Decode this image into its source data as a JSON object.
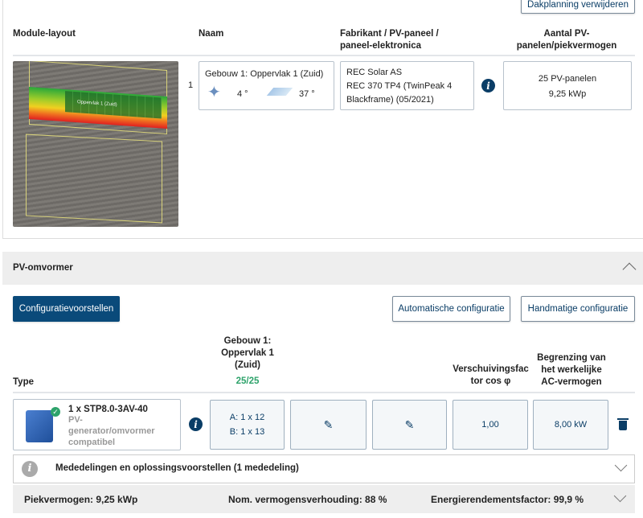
{
  "top_button": "Dakplanning verwijderen",
  "roof": {
    "headers": {
      "layout": "Module-layout",
      "name": "Naam",
      "manufacturer": "Fabrikant / PV-paneel / paneel-elektronica",
      "count": "Aantal PV-panelen/piekvermogen"
    },
    "row": {
      "index": "1",
      "name": "Gebouw 1: Oppervlak 1 (Zuid)",
      "azimuth": "4 °",
      "tilt": "37 °",
      "manufacturer": "REC Solar AS",
      "panel": "REC 370 TP4 (TwinPeak 4 Blackframe) (05/2021)",
      "panel_count": "25 PV-panelen",
      "peak_power": "9,25 kWp",
      "layout_label": "Oppervlak 1 (Zuid)"
    }
  },
  "inverter": {
    "title": "PV-omvormer",
    "buttons": {
      "proposals": "Configuratievoorstellen",
      "auto": "Automatische configuratie",
      "manual": "Handmatige configuratie"
    },
    "headers": {
      "type": "Type",
      "surface": "Gebouw 1: Oppervlak 1 (Zuid)",
      "surface_count": "25/25",
      "cos_phi": "Verschuivingsfactor cos φ",
      "ac_limit": "Begrenzing van het werkelijke AC-vermogen"
    },
    "row": {
      "model": "1 x STP8.0-3AV-40",
      "status": "PV-generator/omvormer compatibel",
      "string_a": "A: 1 x 12",
      "string_b": "B: 1 x 13",
      "cos_phi": "1,00",
      "ac_limit": "8,00 kW"
    },
    "messages": "Mededelingen en oplossingsvoorstellen (1 mededeling)",
    "summary": {
      "peak": "Piekvermogen: 9,25 kWp",
      "ratio": "Nom. vermogensverhouding: 88 %",
      "efficiency": "Energierendementsfactor: 99,9 %"
    }
  },
  "colors": {
    "primary": "#0a4a7a",
    "success": "#2ea36b",
    "panel_bg": "#eeeeee"
  }
}
